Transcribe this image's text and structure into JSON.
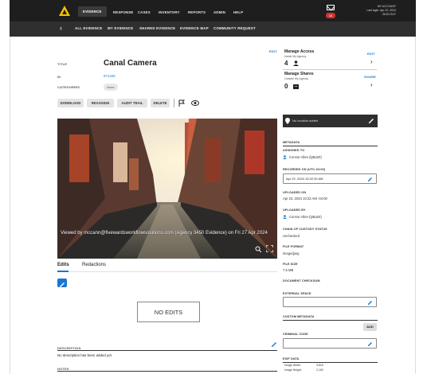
{
  "header": {
    "nav": [
      "EVIDENCE",
      "RESPONSE",
      "CASES",
      "INVENTORY",
      "REPORTS",
      "ADMIN",
      "HELP"
    ],
    "notification_count": "16",
    "user_lines": [
      "MY ACCOUNT",
      "Last login: Apr 22, 2024",
      "SIGN OUT"
    ]
  },
  "subnav": [
    "ALL EVIDENCE",
    "MY EVIDENCE",
    "SHARED EVIDENCE",
    "EVIDENCE MAP",
    "COMMUNITY REQUEST"
  ],
  "details": {
    "title_label": "TITLE",
    "title_value": "Canal Camera",
    "id_label": "ID",
    "id_value": "971425",
    "categories_label": "CATEGORIES",
    "category_chip": "None"
  },
  "actions": [
    "DOWNLOAD",
    "REASSIGN",
    "AUDIT TRAIL",
    "DELETE"
  ],
  "photo": {
    "watermark": "Viewed by mccann@fivewardsworkflowsolutions.com (Agency 3450 Evidence) on Fri 27 Apr 2024"
  },
  "tabs": [
    "Edits",
    "Redactions"
  ],
  "edits": {
    "empty": "NO EDITS"
  },
  "description": {
    "label": "DESCRIPTION",
    "value": "No description has been added yet"
  },
  "notes": {
    "label": "NOTES"
  },
  "manage": {
    "access_title": "Manage Access",
    "access_sub": "Inside My Agency",
    "access_count": "4",
    "access_edit": "EDIT",
    "shares_title": "Manage Shares",
    "shares_sub": "Outside My Agency",
    "shares_count": "0",
    "shares_share": "SHARE",
    "edit_top": "EDIT"
  },
  "right": {
    "location": "No location added",
    "metadata": "METADATA",
    "assigned_label": "ASSIGNED TO",
    "assigned_value": "Connor Allen (lyBa20)",
    "recorded_label": "RECORDED ON (UTC-04:00)",
    "recorded_value": "Apr 22, 2024 10:22:30 AM",
    "uploaded_on_label": "UPLOADED ON",
    "uploaded_on_value": "Apr 23, 2024 10:22 AM -04:00",
    "uploaded_by_label": "UPLOADED BY",
    "uploaded_by_value": "Connor Allen (lyBa20)",
    "chain_label": "CHAIN OF CUSTODY STATUS",
    "chain_value": "Unchecked",
    "format_label": "FILE FORMAT",
    "format_value": "image/jpeg",
    "size_label": "FILE SIZE",
    "size_value": "7.5 MB",
    "checksum_label": "DOCUMENT CHECKSUM",
    "external_label": "EXTERNAL SPACE",
    "custom_label": "CUSTOM METADATA",
    "add_label": "ADD",
    "criminal_label": "CRIMINAL CODE",
    "exif_label": "EXIF DATA",
    "image_width_label": "Image Width:",
    "image_width_value": "3,816",
    "image_height_label": "Image Height:",
    "image_height_value": "2,160"
  }
}
